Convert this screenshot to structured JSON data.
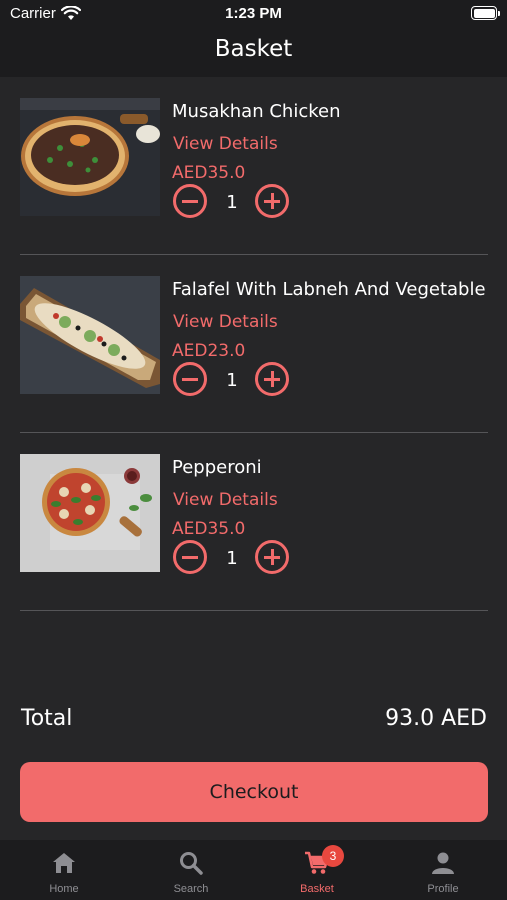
{
  "status_bar": {
    "carrier": "Carrier",
    "time": "1:23 PM"
  },
  "header": {
    "title": "Basket"
  },
  "basket": {
    "items": [
      {
        "name": "Musakhan Chicken",
        "details_label": "View Details",
        "price": "AED35.0",
        "quantity": "1"
      },
      {
        "name": "Falafel With Labneh And Vegetable",
        "details_label": "View Details",
        "price": "AED23.0",
        "quantity": "1"
      },
      {
        "name": "Pepperoni",
        "details_label": "View Details",
        "price": "AED35.0",
        "quantity": "1"
      }
    ]
  },
  "summary": {
    "total_label": "Total",
    "total_value": "93.0 AED"
  },
  "checkout_label": "Checkout",
  "tabs": [
    {
      "label": "Home",
      "icon": "home-icon"
    },
    {
      "label": "Search",
      "icon": "search-icon"
    },
    {
      "label": "Basket",
      "icon": "cart-icon",
      "badge": "3",
      "active": true
    },
    {
      "label": "Profile",
      "icon": "person-icon"
    }
  ],
  "colors": {
    "accent": "#f26b6b",
    "background": "#262628",
    "bar": "#1c1c1e",
    "badge": "#e8483f"
  }
}
